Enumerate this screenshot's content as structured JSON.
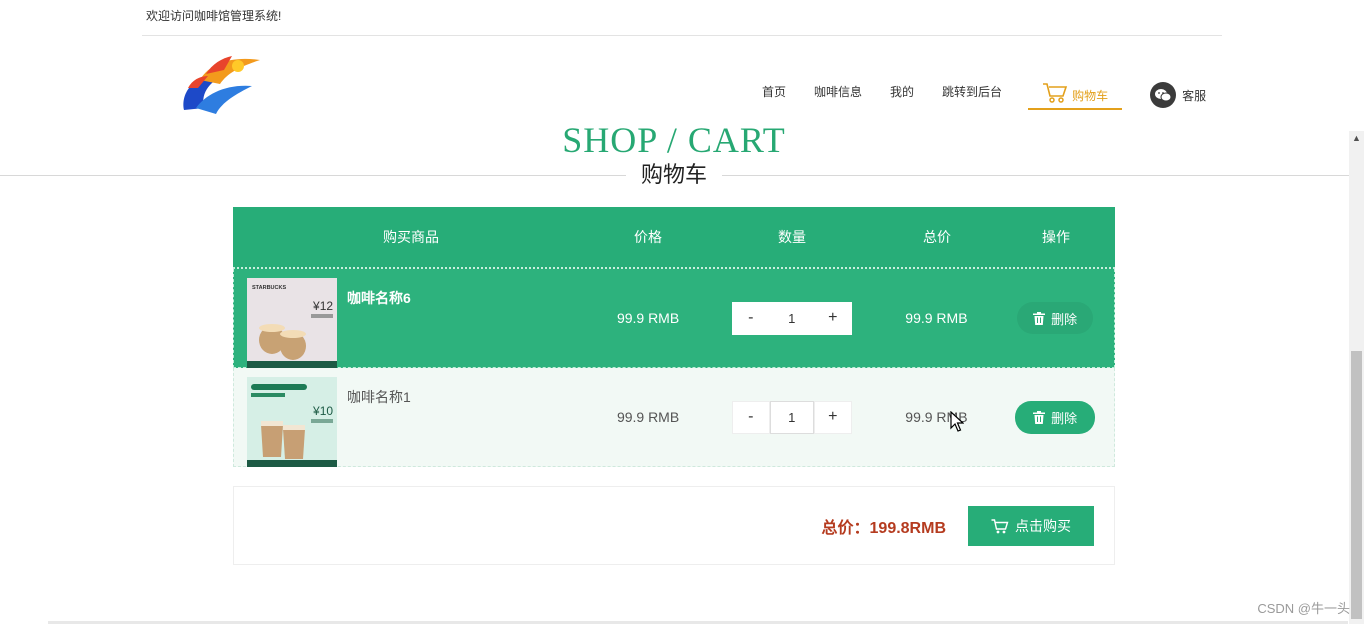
{
  "topbar": {
    "welcome": "欢迎访问咖啡馆管理系统!"
  },
  "nav": {
    "items": [
      "首页",
      "咖啡信息",
      "我的",
      "跳转到后台"
    ],
    "cart": "购物车",
    "service": "客服",
    "active_color": "#e3a01b"
  },
  "page": {
    "title_en": "SHOP / CART",
    "title_cn": "购物车",
    "accent": "#27ad78"
  },
  "cart": {
    "headers": {
      "product": "购买商品",
      "price": "价格",
      "qty": "数量",
      "total": "总价",
      "op": "操作"
    },
    "rows": [
      {
        "name": "咖啡名称6",
        "price": "99.9 RMB",
        "qty": "1",
        "total": "99.9 RMB",
        "delete": "删除",
        "minus": "-",
        "plus": "+",
        "img_brand": "STARBUCKS",
        "img_price": "12"
      },
      {
        "name": "咖啡名称1",
        "price": "99.9 RMB",
        "qty": "1",
        "total": "99.9 RMB",
        "delete": "删除",
        "minus": "-",
        "plus": "+",
        "img_price": "10"
      }
    ]
  },
  "summary": {
    "total": "总价：199.8RMB",
    "buy": "点击购买"
  },
  "watermark": "CSDN @牛一头"
}
